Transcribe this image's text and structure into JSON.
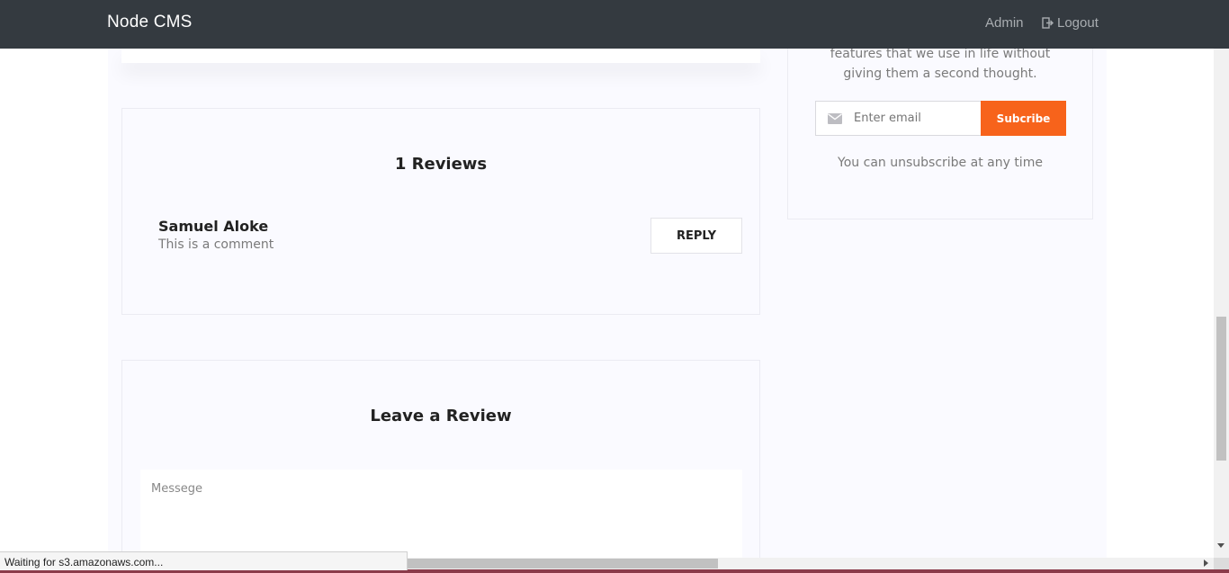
{
  "navbar": {
    "brand": "Node CMS",
    "admin_label": "Admin",
    "logout_label": "Logout"
  },
  "reviews": {
    "title": "1 Reviews",
    "items": [
      {
        "author": "Samuel Aloke",
        "text": "This is a comment",
        "reply_label": "REPLY"
      }
    ]
  },
  "leave_review": {
    "title": "Leave a Review",
    "message_placeholder": "Messege"
  },
  "sidebar": {
    "text_line1": "features that we use in life without",
    "text_line2": "giving them a second thought.",
    "email_placeholder": "Enter email",
    "subscribe_label": "Subcribe",
    "unsubscribe_note": "You can unsubscribe at any time"
  },
  "status_bar": {
    "text": "Waiting for s3.amazonaws.com..."
  },
  "colors": {
    "navbar_bg": "#343a40",
    "accent": "#f7631b",
    "page_bg": "#fafaff"
  }
}
